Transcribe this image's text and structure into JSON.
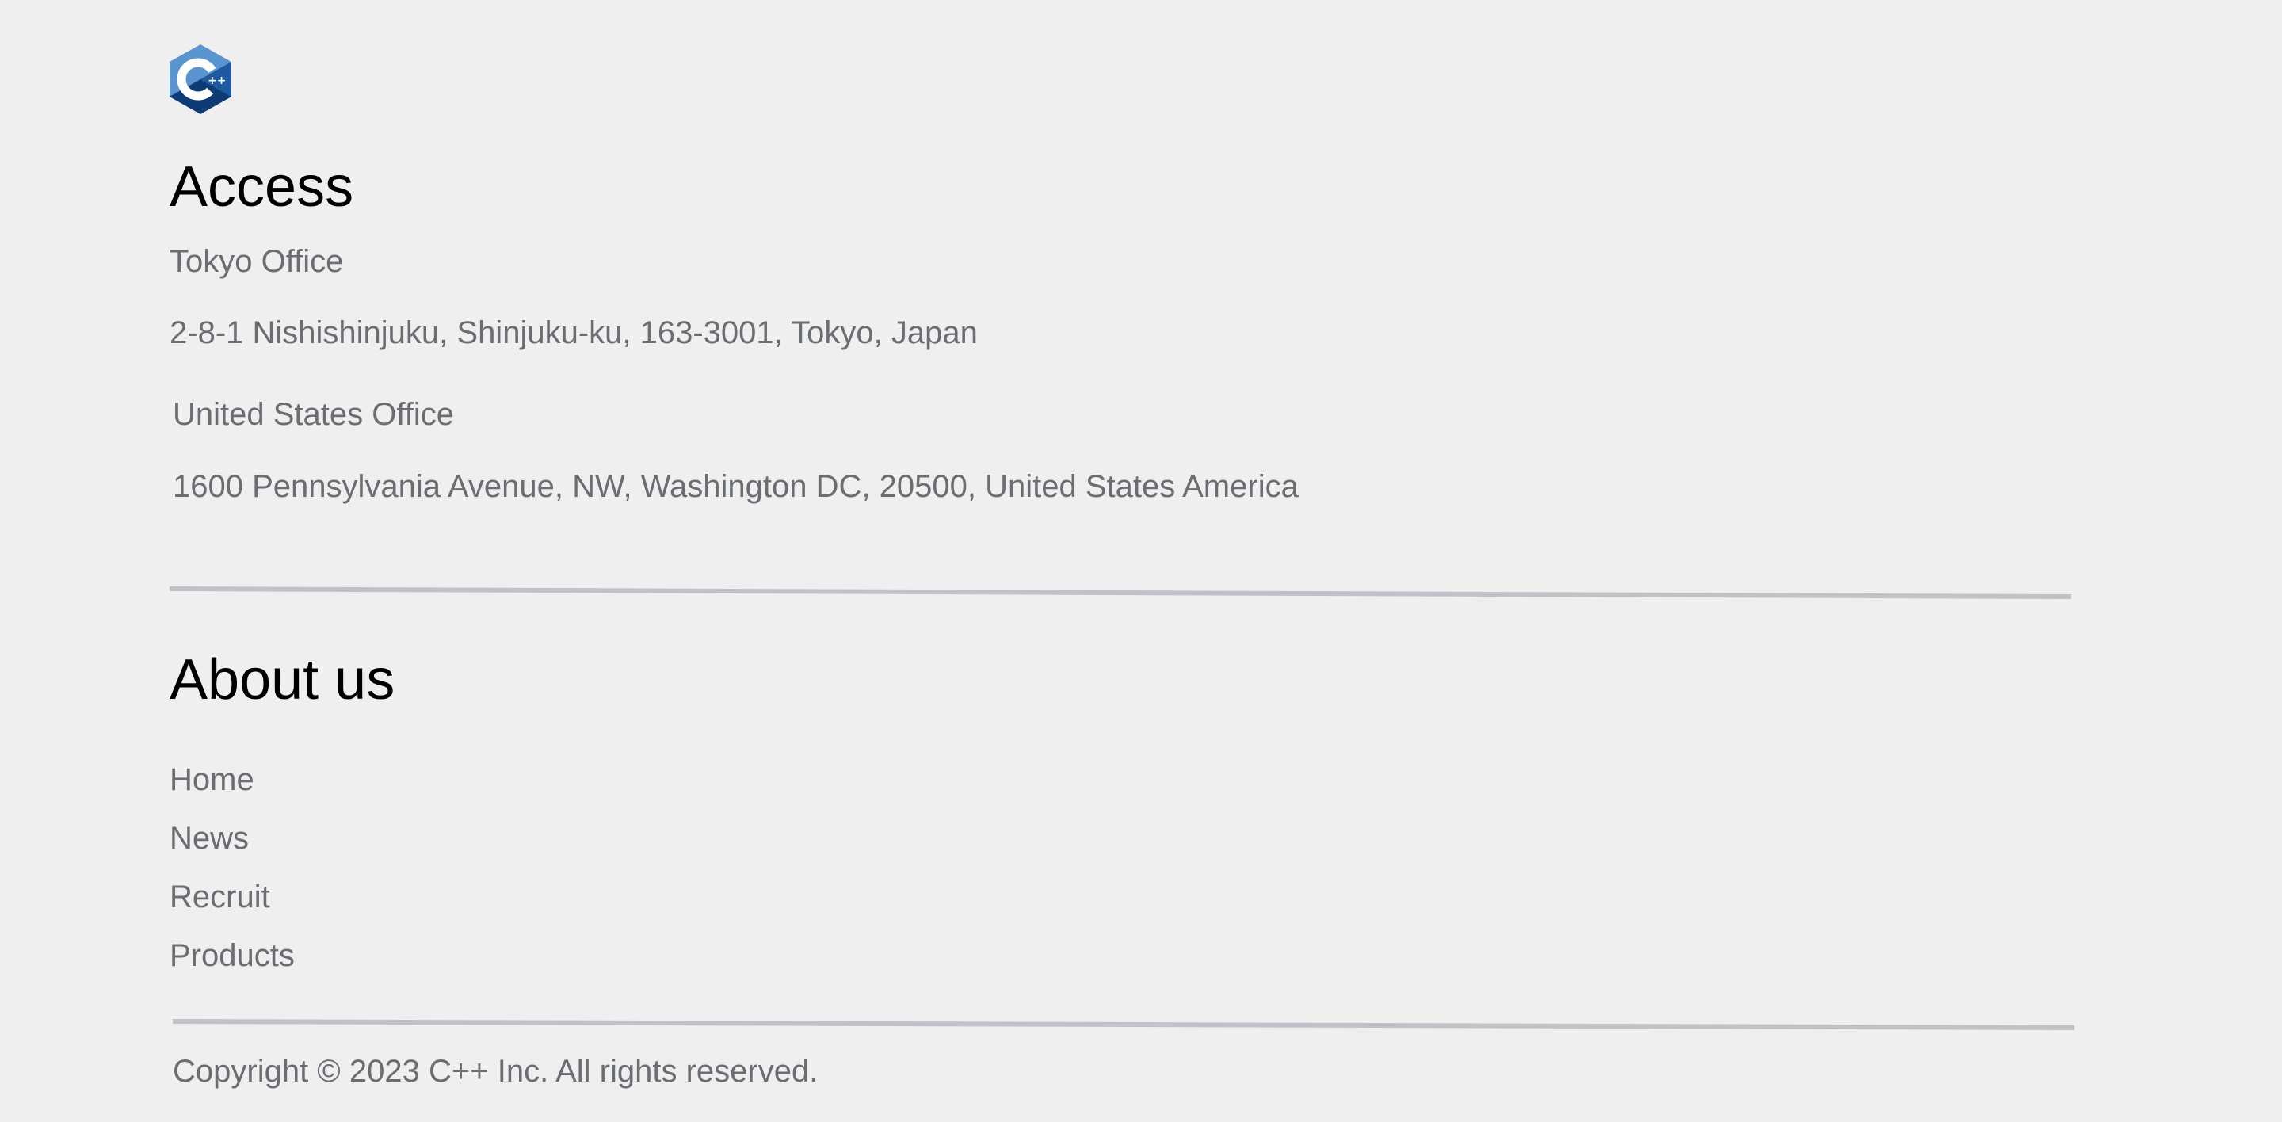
{
  "brand": {
    "logo_icon": "cpp-hexagon-logo-icon",
    "logo_colors": [
      "#5b95cf",
      "#1f5aa0",
      "#0f3b75"
    ]
  },
  "access": {
    "heading": "Access",
    "offices": [
      {
        "name": "Tokyo Office",
        "address": "2-8-1 Nishishinjuku, Shinjuku-ku, 163-3001, Tokyo, Japan"
      },
      {
        "name": "United States Office",
        "address": "1600 Pennsylvania Avenue, NW, Washington DC, 20500, United States America"
      }
    ]
  },
  "about": {
    "heading": "About us",
    "links": [
      {
        "label": "Home"
      },
      {
        "label": "News"
      },
      {
        "label": "Recruit"
      },
      {
        "label": "Products"
      }
    ]
  },
  "footer": {
    "copyright": "Copyright © 2023 C++ Inc. All rights reserved."
  },
  "colors": {
    "background": "#efefef",
    "heading": "#000000",
    "body_text": "#6a6d72",
    "divider": "#bfc2c6"
  }
}
